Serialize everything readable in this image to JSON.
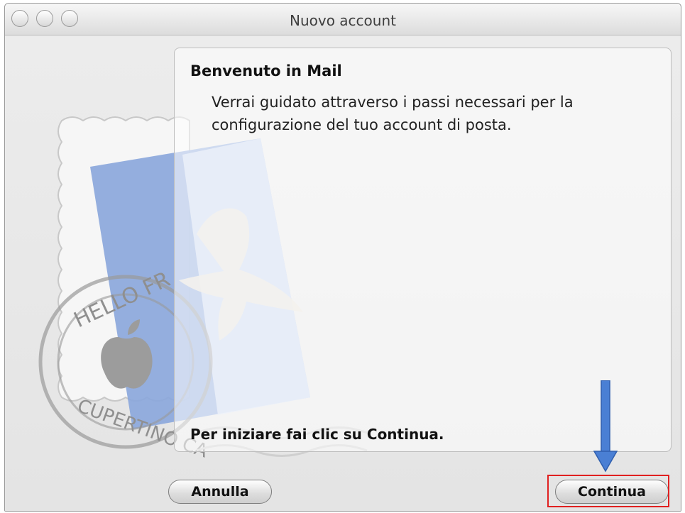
{
  "window": {
    "title": "Nuovo account"
  },
  "welcome": {
    "heading": "Benvenuto in Mail",
    "description": "Verrai guidato attraverso i passi necessari per la configurazione del tuo account di posta.",
    "start_prompt": "Per iniziare fai clic su Continua."
  },
  "buttons": {
    "cancel_label": "Annulla",
    "continue_label": "Continua"
  },
  "stamp": {
    "postmark_text_top": "HELLO FR",
    "postmark_text_bottom": "CUPERTINO CA"
  },
  "colors": {
    "highlight": "#e02020",
    "arrow": "#4a7fd4",
    "stamp_blue": "#8aa6dc"
  }
}
